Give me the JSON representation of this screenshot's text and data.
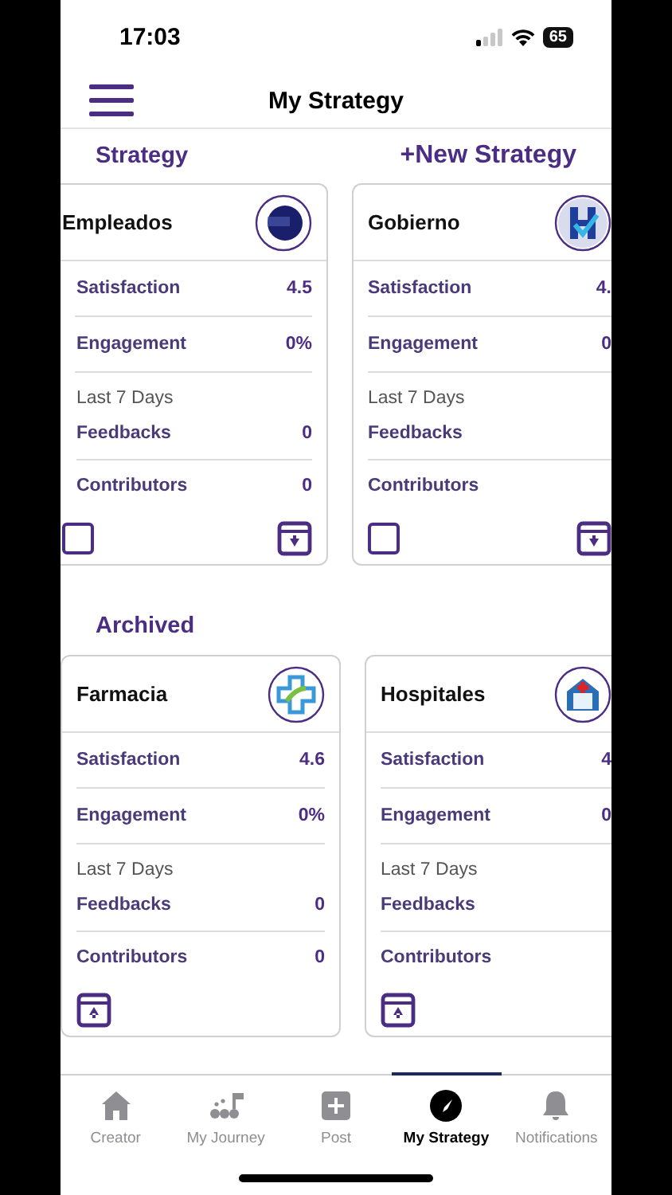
{
  "status_bar": {
    "time": "17:03",
    "battery": "65"
  },
  "header": {
    "title": "My Strategy"
  },
  "sections": [
    {
      "kind": "active",
      "title": "Strategy",
      "action": "+New Strategy",
      "cards": [
        {
          "name": "Empleados",
          "metrics": [
            {
              "label": "Satisfaction",
              "value": "4.5"
            },
            {
              "label": "Engagement",
              "value": "0%"
            }
          ],
          "period_label": "Last 7 Days",
          "period_metrics": [
            {
              "label": "Feedbacks",
              "value": "0"
            },
            {
              "label": "Contributors",
              "value": "0"
            }
          ],
          "checkbox": {
            "checked": false
          }
        },
        {
          "name": "Gobierno",
          "metrics": [
            {
              "label": "Satisfaction",
              "value": "4."
            },
            {
              "label": "Engagement",
              "value": "0"
            }
          ],
          "period_label": "Last 7 Days",
          "period_metrics": [
            {
              "label": "Feedbacks"
            },
            {
              "label": "Contributors"
            }
          ],
          "checkbox": {
            "checked": false
          }
        }
      ]
    },
    {
      "kind": "archived",
      "title": "Archived",
      "cards": [
        {
          "name": "Farmacia",
          "metrics": [
            {
              "label": "Satisfaction",
              "value": "4.6"
            },
            {
              "label": "Engagement",
              "value": "0%"
            }
          ],
          "period_label": "Last 7 Days",
          "period_metrics": [
            {
              "label": "Feedbacks",
              "value": "0"
            },
            {
              "label": "Contributors",
              "value": "0"
            }
          ]
        },
        {
          "name": "Hospitales",
          "metrics": [
            {
              "label": "Satisfaction",
              "value": "4"
            },
            {
              "label": "Engagement",
              "value": "0"
            }
          ],
          "period_label": "Last 7 Days",
          "period_metrics": [
            {
              "label": "Feedbacks"
            },
            {
              "label": "Contributors"
            }
          ]
        }
      ]
    }
  ],
  "tab_bar": [
    {
      "label": "Creator",
      "selected": false
    },
    {
      "label": "My Journey",
      "selected": false
    },
    {
      "label": "Post",
      "selected": false
    },
    {
      "label": "My Strategy",
      "selected": true
    },
    {
      "label": "Notifications",
      "selected": false
    }
  ]
}
